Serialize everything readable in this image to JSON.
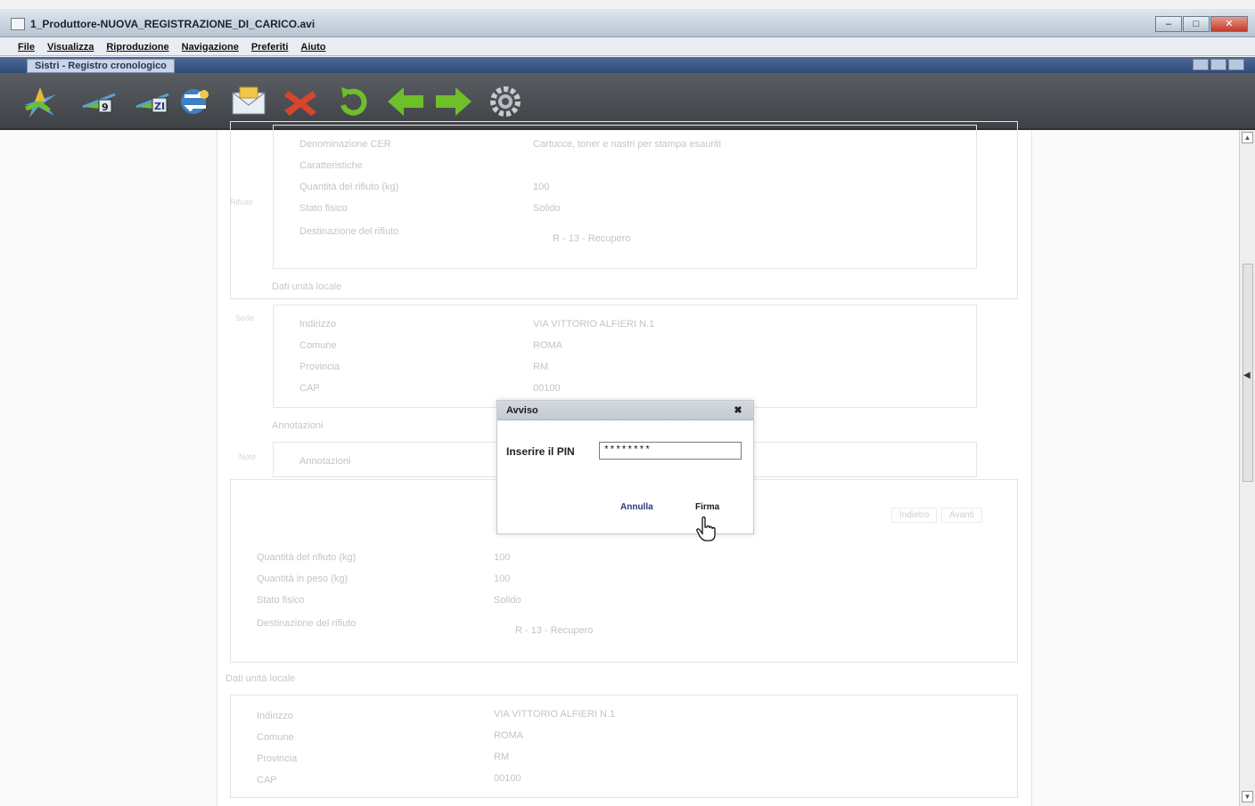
{
  "window": {
    "title": "1_Produttore-NUOVA_REGISTRAZIONE_DI_CARICO.avi",
    "controls": [
      "–",
      "□",
      "✕"
    ]
  },
  "menu": [
    "File",
    "Visualizza",
    "Riproduzione",
    "Navigazione",
    "Preferiti",
    "Aiuto"
  ],
  "subbar": {
    "breadcrumb": "Sistri - Registro cronologico"
  },
  "toolbar": {
    "icons": [
      "new-record-icon",
      "new-record-2-icon",
      "new-record-3-icon",
      "transfer-icon",
      "envelope-icon",
      "delete-x-icon",
      "refresh-icon",
      "back-arrow-icon",
      "forward-arrow-icon",
      "settings-gear-icon"
    ]
  },
  "form": {
    "upper_rows": [
      {
        "label": "Denominazione CER",
        "value": "Cartucce, toner e nastri per stampa esauriti"
      },
      {
        "label": "Caratteristiche",
        "value": ""
      },
      {
        "label": "Quantità del rifiuto (kg)",
        "value": "100"
      },
      {
        "label": "Stato fisico",
        "value": "Solido"
      },
      {
        "label": "Destinazione del rifiuto",
        "value": "R - 13 - Recupero"
      }
    ],
    "upper_side": "Rifiuto",
    "site_legend": "Dati unità locale",
    "site_side": "Sede",
    "site_rows": [
      {
        "label": "Indirizzo",
        "value": "VIA VITTORIO ALFIERI N.1"
      },
      {
        "label": "Comune",
        "value": "ROMA"
      },
      {
        "label": "Provincia",
        "value": "RM"
      },
      {
        "label": "CAP",
        "value": "00100"
      }
    ],
    "notes_legend": "Annotazioni",
    "notes_side": "Note",
    "notes_label": "Annotazioni",
    "nav_buttons": [
      "Indietro",
      "Avanti"
    ],
    "lower_rows": [
      {
        "label": "Quantità del rifiuto (kg)",
        "value": "100"
      },
      {
        "label": "Quantità in peso (kg)",
        "value": "100"
      },
      {
        "label": "Stato fisico",
        "value": "Solido"
      },
      {
        "label": "Destinazione del rifiuto",
        "value": "R - 13 - Recupero"
      }
    ],
    "bottom_legend": "Dati unità locale",
    "bottom_rows": [
      {
        "label": "Indirizzo",
        "value": "VIA VITTORIO ALFIERI N.1"
      },
      {
        "label": "Comune",
        "value": "ROMA"
      },
      {
        "label": "Provincia",
        "value": "RM"
      },
      {
        "label": "CAP",
        "value": "00100"
      }
    ]
  },
  "dialog": {
    "title": "Avviso",
    "close_glyph": "✖",
    "pin_label": "Inserire il PIN",
    "pin_value": "********",
    "cancel_label": "Annulla",
    "sign_label": "Firma"
  },
  "scrollbar": {
    "up": "▲",
    "down": "▼",
    "pointer": "◀"
  },
  "colors": {
    "toolbar_bg": "#4a4e52",
    "arrow_green": "#6fbf2a",
    "delete_red": "#d9452b",
    "dialog_title_bg": "#c8ced6"
  }
}
